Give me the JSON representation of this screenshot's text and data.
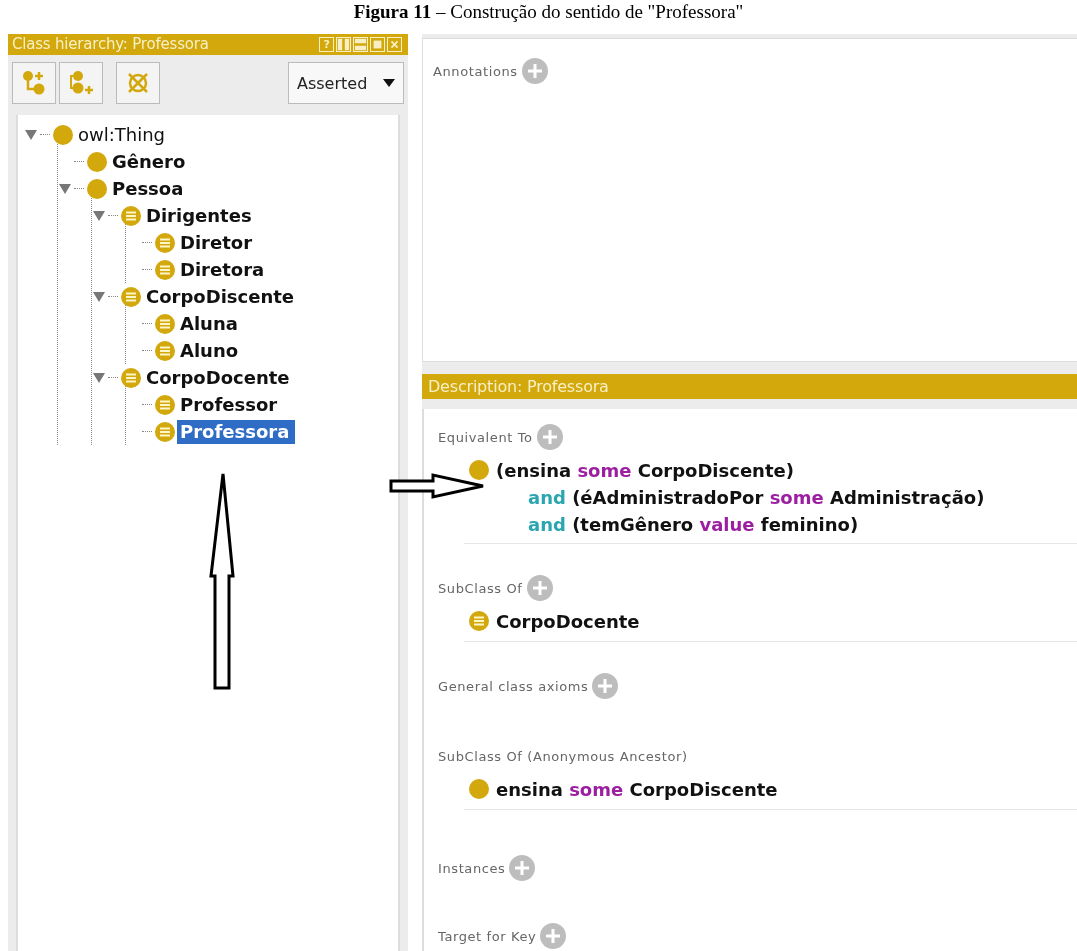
{
  "caption": "**Figura 11** – Construção do sentido de \"Professora\"",
  "class_hierarchy": {
    "title": "Class hierarchy: Professora",
    "help": "?",
    "toolbar": {
      "buttons": [
        {
          "kind": "add-sub"
        },
        {
          "kind": "add-sibling"
        },
        {
          "kind": "delete"
        }
      ],
      "dropdown": "Asserted"
    },
    "tree": [
      {
        "label": "owl:Thing",
        "kind": "primitive",
        "expanded": true,
        "selected": false,
        "children": [
          {
            "label": "Gênero",
            "kind": "primitive",
            "selected": false
          },
          {
            "label": "Pessoa",
            "kind": "primitive",
            "expanded": true,
            "selected": false,
            "children": [
              {
                "label": "Dirigentes",
                "kind": "defined",
                "expanded": true,
                "selected": false,
                "children": [
                  {
                    "label": "Diretor",
                    "kind": "defined",
                    "selected": false
                  },
                  {
                    "label": "Diretora",
                    "kind": "defined",
                    "selected": false
                  }
                ]
              },
              {
                "label": "CorpoDiscente",
                "kind": "defined",
                "expanded": true,
                "selected": false,
                "children": [
                  {
                    "label": "Aluna",
                    "kind": "defined",
                    "selected": false
                  },
                  {
                    "label": "Aluno",
                    "kind": "defined",
                    "selected": false
                  }
                ]
              },
              {
                "label": "CorpoDocente",
                "kind": "defined",
                "expanded": true,
                "selected": false,
                "children": [
                  {
                    "label": "Professor",
                    "kind": "defined",
                    "selected": false
                  },
                  {
                    "label": "Professora",
                    "kind": "defined",
                    "selected": true
                  }
                ]
              }
            ]
          }
        ]
      }
    ]
  },
  "annotations": {
    "label": "Annotations"
  },
  "description": {
    "title": "Description: Professora",
    "sections": [
      {
        "label": "Equivalent To",
        "addable": true,
        "items": [
          {
            "kind": "anonymous",
            "lines": [
              [
                {
                  "kind": "plain",
                  "text": "(ensina"
                },
                {
                  "kind": "quantifier",
                  "text": "some"
                },
                {
                  "kind": "plain",
                  "text": "CorpoDiscente)"
                }
              ],
              [
                {
                  "kind": "connective",
                  "text": "and"
                },
                {
                  "kind": "plain",
                  "text": "(éAdministradoPor"
                },
                {
                  "kind": "quantifier",
                  "text": "some"
                },
                {
                  "kind": "plain",
                  "text": "Administração)"
                }
              ],
              [
                {
                  "kind": "connective",
                  "text": "and"
                },
                {
                  "kind": "plain",
                  "text": "(temGênero"
                },
                {
                  "kind": "quantifier",
                  "text": "value"
                },
                {
                  "kind": "plain",
                  "text": "feminino)"
                }
              ]
            ]
          }
        ]
      },
      {
        "label": "SubClass Of",
        "addable": true,
        "items": [
          {
            "kind": "defined",
            "lines": [
              [
                {
                  "kind": "plain",
                  "text": "CorpoDocente"
                }
              ]
            ]
          }
        ]
      },
      {
        "label": "General class axioms",
        "addable": true
      },
      {
        "label": "SubClass Of (Anonymous Ancestor)",
        "addable": false,
        "items": [
          {
            "kind": "anonymous",
            "lines": [
              [
                {
                  "kind": "plain",
                  "text": "ensina"
                },
                {
                  "kind": "quantifier",
                  "text": "some"
                },
                {
                  "kind": "plain",
                  "text": "CorpoDiscente"
                }
              ]
            ]
          }
        ]
      },
      {
        "label": "Instances",
        "addable": true
      },
      {
        "label": "Target for Key",
        "addable": true
      }
    ]
  }
}
